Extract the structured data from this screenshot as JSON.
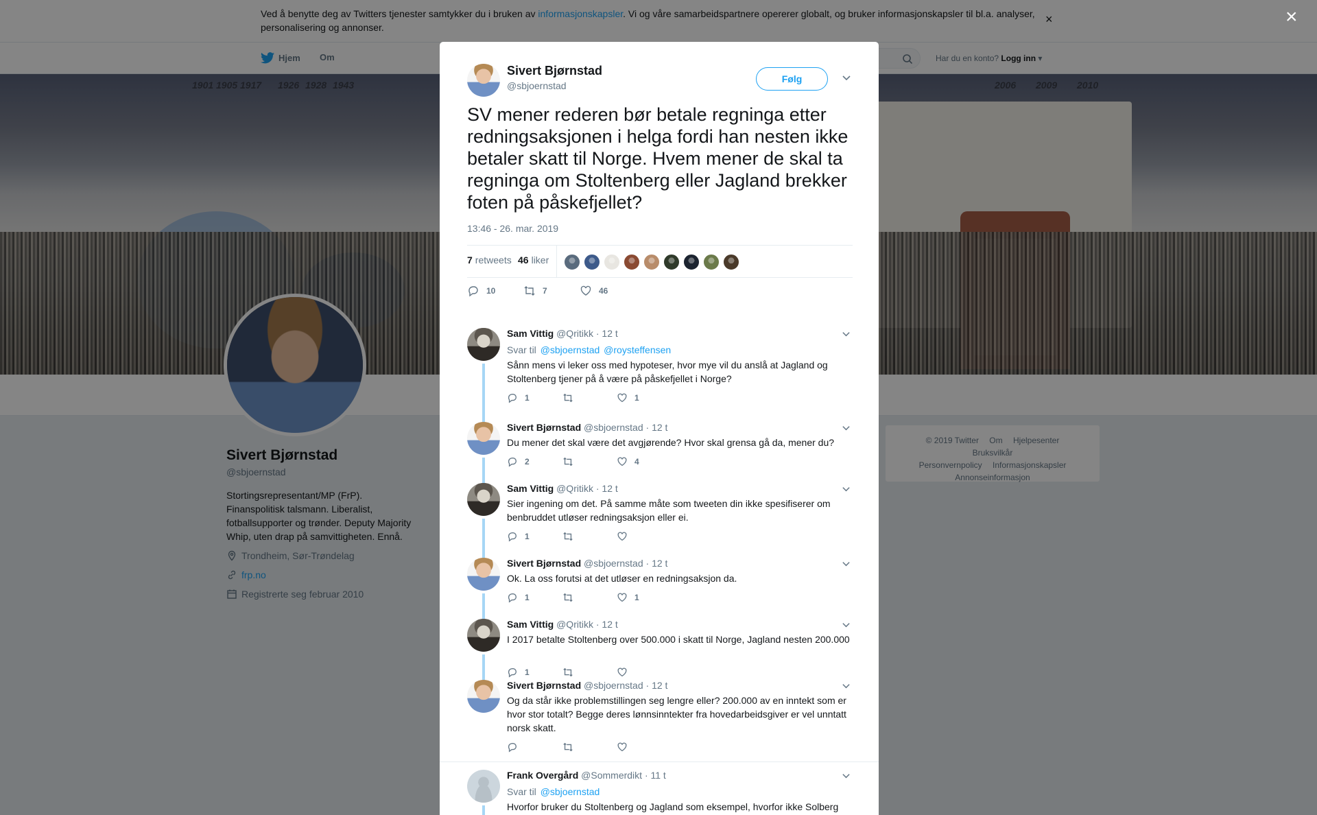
{
  "cookie": {
    "text_before": "Ved å benytte deg av Twitters tjenester samtykker du i bruken av ",
    "link": "informasjonskapsler",
    "text_after": ". Vi og våre samarbeidspartnere opererer globalt, og bruker informasjonskapsler til bl.a. analyser, personalisering og annonser.",
    "close": "×"
  },
  "nav": {
    "home": "Hjem",
    "about": "Om",
    "login_prompt": "Har du en konto?",
    "login": "Logg inn"
  },
  "banner": {
    "years": [
      "1901",
      "1905",
      "1917",
      "1926",
      "1928",
      "1943",
      "2006",
      "2009",
      "2010"
    ]
  },
  "profile": {
    "name": "Sivert Bjørnstad",
    "handle": "@sbjoernstad",
    "bio": "Stortingsrepresentant/MP (FrP). Finanspolitisk talsmann. Liberalist, fotballsupporter og trønder. Deputy Majority Whip, uten drap på samvittigheten. Ennå.",
    "location": "Trondheim, Sør-Trøndelag",
    "website": "frp.no",
    "joined": "Registrerte seg februar 2010"
  },
  "footer": {
    "links": [
      "© 2019 Twitter",
      "Om",
      "Hjelpesenter",
      "Bruksvilkår",
      "Personvernpolicy",
      "Informasjonskapsler",
      "Annonseinformasjon"
    ]
  },
  "modal": {
    "close": "×",
    "author_name": "Sivert Bjørnstad",
    "author_handle": "@sbjoernstad",
    "follow": "Følg",
    "text": "SV mener rederen bør betale regninga etter redningsaksjonen i helga fordi han nesten ikke betaler skatt til Norge. Hvem mener de skal ta regninga om Stoltenberg eller Jagland brekker foten på påskefjellet?",
    "timestamp": "13:46 - 26. mar. 2019",
    "retweets_count": "7",
    "retweets_label": "retweets",
    "likes_count": "46",
    "likes_label": "liker",
    "liker_colors": [
      "#5a6b7d",
      "#3d5a8a",
      "#e8e6e1",
      "#8a4a32",
      "#b88c6a",
      "#2f3a2a",
      "#1c2430",
      "#6b7a4a",
      "#4a3a2a"
    ],
    "reply_count": "10",
    "retweet_count": "7",
    "like_count": "46"
  },
  "replies": [
    {
      "name": "Sam Vittig",
      "handle": "@Qritikk",
      "time": "· 12 t",
      "avatar": "sam",
      "reply_to_label": "Svar til",
      "reply_to": [
        "@sbjoernstad",
        "@roysteffensen"
      ],
      "text": "Sånn mens vi leker oss med hypoteser, hvor mye vil du anslå at Jagland og Stoltenberg tjener på å være på påskefjellet i Norge?",
      "replies": "1",
      "retweets": "",
      "likes": "1"
    },
    {
      "name": "Sivert Bjørnstad",
      "handle": "@sbjoernstad",
      "time": "· 12 t",
      "avatar": "sivert",
      "text": "Du mener det skal være det avgjørende? Hvor skal grensa gå da, mener du?",
      "replies": "2",
      "retweets": "",
      "likes": "4"
    },
    {
      "name": "Sam Vittig",
      "handle": "@Qritikk",
      "time": "· 12 t",
      "avatar": "sam",
      "text": "Sier ingening om det. På samme måte som tweeten din ikke spesifiserer om benbruddet utløser redningsaksjon eller ei.",
      "replies": "1",
      "retweets": "",
      "likes": ""
    },
    {
      "name": "Sivert Bjørnstad",
      "handle": "@sbjoernstad",
      "time": "· 12 t",
      "avatar": "sivert",
      "text": "Ok. La oss forutsi at det utløser en redningsaksjon da.",
      "replies": "1",
      "retweets": "",
      "likes": "1"
    },
    {
      "name": "Sam Vittig",
      "handle": "@Qritikk",
      "time": "· 12 t",
      "avatar": "sam",
      "text": "I 2017 betalte Stoltenberg over 500.000 i skatt til Norge, Jagland nesten 200.000",
      "replies": "1",
      "retweets": "",
      "likes": ""
    },
    {
      "name": "Sivert Bjørnstad",
      "handle": "@sbjoernstad",
      "time": "· 12 t",
      "avatar": "sivert",
      "text": "Og da står ikke problemstillingen seg lengre eller? 200.000 av en inntekt som er hvor stor totalt? Begge deres lønnsinntekter fra hovedarbeidsgiver er vel unntatt norsk skatt.",
      "replies": "",
      "retweets": "",
      "likes": ""
    },
    {
      "name": "Frank Overgård",
      "handle": "@Sommerdikt",
      "time": "· 11 t",
      "avatar": "frank",
      "reply_to_label": "Svar til",
      "reply_to": [
        "@sbjoernstad"
      ],
      "text": "Hvorfor bruker du Stoltenberg og Jagland som eksempel, hvorfor ikke Solberg",
      "replies": "",
      "retweets": "",
      "likes": ""
    }
  ]
}
